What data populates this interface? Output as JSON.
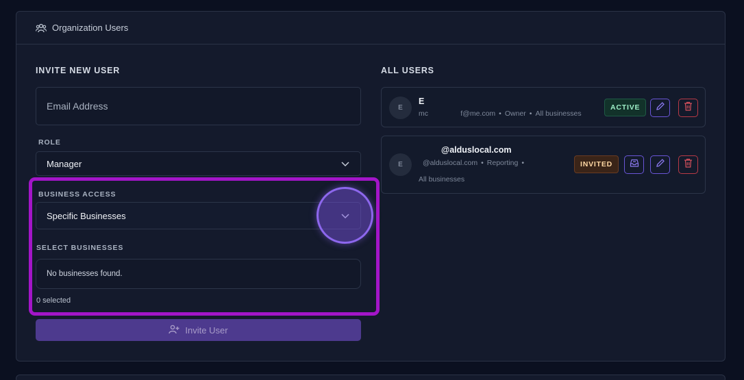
{
  "header": {
    "title": "Organization Users",
    "icon": "users-icon"
  },
  "invite": {
    "section_title": "INVITE NEW USER",
    "email_placeholder": "Email Address",
    "role_label": "ROLE",
    "role_value": "Manager",
    "access_label": "BUSINESS ACCESS",
    "access_value": "Specific Businesses",
    "select_label": "SELECT BUSINESSES",
    "no_businesses": "No businesses found.",
    "selected_count": "0 selected",
    "invite_button": "Invite User"
  },
  "all_users": {
    "section_title": "ALL USERS",
    "users": [
      {
        "initial": "E",
        "name": "E",
        "email_prefix": "mc",
        "email_suffix": "f@me.com",
        "role": "Owner",
        "scope": "All businesses",
        "status": "ACTIVE"
      },
      {
        "initial": "E",
        "name": "@alduslocal.com",
        "email": "@alduslocal.com",
        "role": "Reporting",
        "scope": "All businesses",
        "status": "INVITED"
      }
    ]
  },
  "colors": {
    "background": "#0b1020",
    "card": "#141a2c",
    "accent_purple": "#6a56d8",
    "danger_red": "#b93a46",
    "highlight": "#a315c8"
  }
}
